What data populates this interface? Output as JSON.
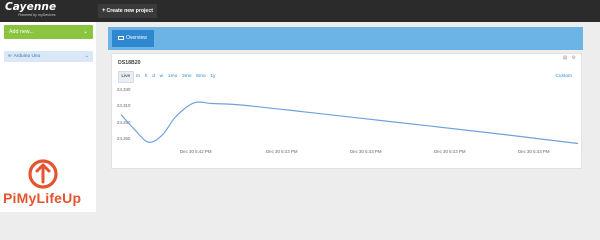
{
  "app": {
    "brand": "Cayenne",
    "brand_sub": "Powered by myDevices"
  },
  "toolbar": {
    "create_label": "Create new project"
  },
  "sidebar": {
    "add_new_label": "Add new...",
    "devices": [
      {
        "label": "Arduino Uno",
        "icon": "link-icon"
      }
    ]
  },
  "overview": {
    "tab_label": "Overview",
    "icon": "dashboard-icon"
  },
  "widget": {
    "title": "DS18B20",
    "ranges": [
      "Live",
      "m",
      "h",
      "d",
      "w",
      "1mo",
      "3mo",
      "6mo",
      "1y"
    ],
    "active_range": "Live",
    "custom_label": "Custom"
  },
  "chart_data": {
    "type": "line",
    "xlabel": "",
    "ylabel": "",
    "y_ticks": [
      "24.340",
      "24.310",
      "24.280",
      "24.260"
    ],
    "x_ticks": [
      "Dec 30 5:42 PM",
      "Dec 30 5:43 PM",
      "Dec 30 5:43 PM",
      "Dec 30 5:43 PM",
      "Dec 30 5:43 PM"
    ],
    "series": [
      {
        "color": "#6fa1df",
        "x": [
          0,
          3,
          6,
          9,
          12,
          16,
          20,
          26,
          40,
          60,
          80,
          100
        ],
        "values": [
          24.305,
          24.283,
          24.265,
          24.275,
          24.302,
          24.322,
          24.321,
          24.319,
          24.309,
          24.294,
          24.279,
          24.263
        ]
      }
    ],
    "x_range": [
      0,
      100
    ],
    "ylim": [
      24.255,
      24.345
    ],
    "grid": false
  },
  "footer": {
    "logo_text": "PiMyLifeUp"
  }
}
